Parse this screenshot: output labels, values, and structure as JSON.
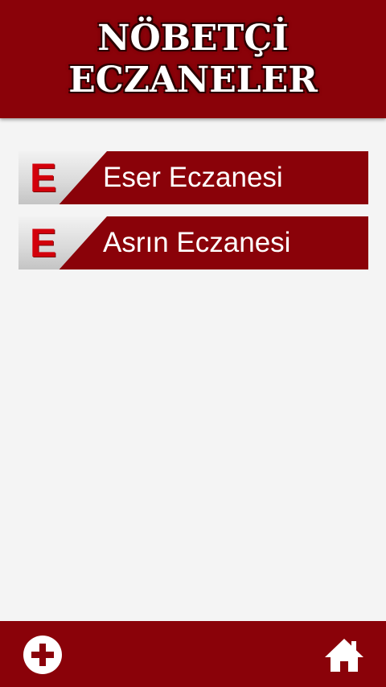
{
  "header": {
    "title_line1": "NÖBETÇİ",
    "title_line2": "ECZANELER"
  },
  "pharmacies": [
    {
      "badge": "E",
      "name": "Eser Eczanesi"
    },
    {
      "badge": "E",
      "name": "Asrın Eczanesi"
    }
  ],
  "footer": {
    "left_icon": "plus-circle-icon",
    "right_icon": "home-icon"
  },
  "colors": {
    "brand": "#8a0209",
    "badge_letter": "#d3000b",
    "background": "#f4f4f4"
  }
}
